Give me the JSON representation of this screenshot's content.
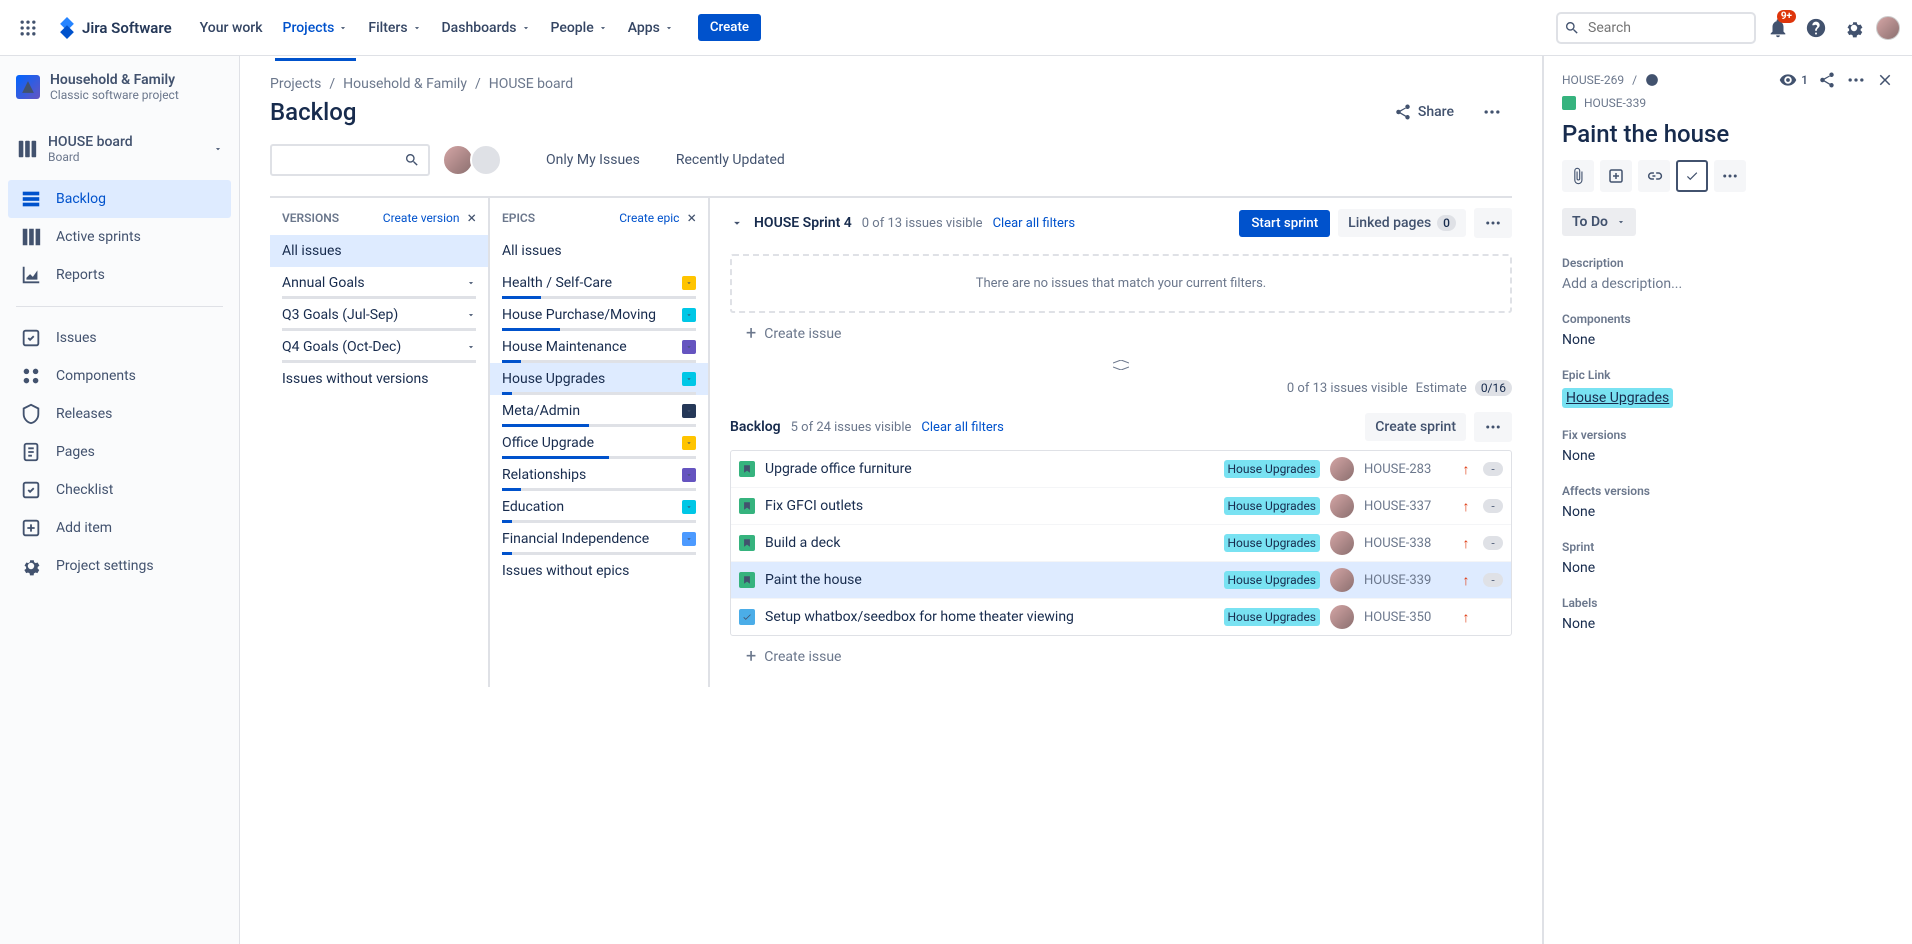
{
  "nav": {
    "logo": "Jira Software",
    "items": [
      "Your work",
      "Projects",
      "Filters",
      "Dashboards",
      "People",
      "Apps"
    ],
    "activeIndex": 1,
    "create": "Create",
    "searchPlaceholder": "Search",
    "notificationBadge": "9+"
  },
  "sidebar": {
    "projectName": "Household & Family",
    "projectType": "Classic software project",
    "boardName": "HOUSE board",
    "boardType": "Board",
    "boardNav": [
      "Backlog",
      "Active sprints",
      "Reports"
    ],
    "selectedBoardNav": 0,
    "projectNav": [
      "Issues",
      "Components",
      "Releases",
      "Pages",
      "Checklist",
      "Add item",
      "Project settings"
    ]
  },
  "breadcrumbs": [
    "Projects",
    "Household & Family",
    "HOUSE board"
  ],
  "pageTitle": "Backlog",
  "shareLabel": "Share",
  "quickFilters": [
    "Only My Issues",
    "Recently Updated"
  ],
  "versionsPanel": {
    "title": "VERSIONS",
    "link": "Create version",
    "items": [
      "All issues",
      "Annual Goals",
      "Q3 Goals (Jul-Sep)",
      "Q4 Goals (Oct-Dec)",
      "Issues without versions"
    ],
    "selected": 0
  },
  "epicsPanel": {
    "title": "EPICS",
    "link": "Create epic",
    "items": [
      {
        "name": "All issues",
        "color": null,
        "progress": null
      },
      {
        "name": "Health / Self-Care",
        "color": "#ffc400",
        "progress": 20
      },
      {
        "name": "House Purchase/Moving",
        "color": "#00c7e6",
        "progress": 30
      },
      {
        "name": "House Maintenance",
        "color": "#6554c0",
        "progress": 10
      },
      {
        "name": "House Upgrades",
        "color": "#00c7e6",
        "progress": 5
      },
      {
        "name": "Meta/Admin",
        "color": "#253858",
        "progress": 45
      },
      {
        "name": "Office Upgrade",
        "color": "#ffc400",
        "progress": 55
      },
      {
        "name": "Relationships",
        "color": "#6554c0",
        "progress": 10
      },
      {
        "name": "Education",
        "color": "#00c7e6",
        "progress": 5
      },
      {
        "name": "Financial Independence",
        "color": "#4c9aff",
        "progress": 5
      },
      {
        "name": "Issues without epics",
        "color": null,
        "progress": null
      }
    ],
    "selected": 4
  },
  "sprint": {
    "name": "HOUSE Sprint 4",
    "meta": "0 of 13 issues visible",
    "clear": "Clear all filters",
    "startBtn": "Start sprint",
    "linkedPages": "Linked pages",
    "linkedCount": "0",
    "emptyMsg": "There are no issues that match your current filters.",
    "createIssue": "Create issue",
    "estimateMeta": "0 of 13 issues visible",
    "estimateLabel": "Estimate",
    "estimateVal": "0/16"
  },
  "backlog": {
    "title": "Backlog",
    "meta": "5 of 24 issues visible",
    "clear": "Clear all filters",
    "createSprint": "Create sprint",
    "issues": [
      {
        "type": "story",
        "summary": "Upgrade office furniture",
        "epic": "House Upgrades",
        "key": "HOUSE-283",
        "est": "-"
      },
      {
        "type": "story",
        "summary": "Fix GFCI outlets",
        "epic": "House Upgrades",
        "key": "HOUSE-337",
        "est": "-"
      },
      {
        "type": "story",
        "summary": "Build a deck",
        "epic": "House Upgrades",
        "key": "HOUSE-338",
        "est": "-"
      },
      {
        "type": "story",
        "summary": "Paint the house",
        "epic": "House Upgrades",
        "key": "HOUSE-339",
        "est": "-"
      },
      {
        "type": "task",
        "summary": "Setup whatbox/seedbox for home theater viewing",
        "epic": "House Upgrades",
        "key": "HOUSE-350",
        "est": null
      }
    ],
    "selectedKey": "HOUSE-339",
    "createIssue": "Create issue"
  },
  "detail": {
    "parentKey": "HOUSE-269",
    "key": "HOUSE-339",
    "watchCount": "1",
    "title": "Paint the house",
    "status": "To Do",
    "fields": {
      "descriptionLabel": "Description",
      "descriptionPlaceholder": "Add a description...",
      "componentsLabel": "Components",
      "componentsVal": "None",
      "epicLinkLabel": "Epic Link",
      "epicLinkVal": "House Upgrades",
      "fixVersionsLabel": "Fix versions",
      "fixVersionsVal": "None",
      "affectsVersionsLabel": "Affects versions",
      "affectsVersionsVal": "None",
      "sprintLabel": "Sprint",
      "sprintVal": "None",
      "labelsLabel": "Labels",
      "labelsVal": "None"
    }
  }
}
